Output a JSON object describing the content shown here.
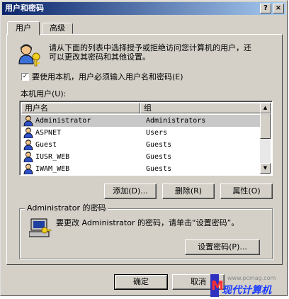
{
  "window": {
    "title": "用户和密码",
    "help_btn": "?",
    "close_btn": "×"
  },
  "tabs": [
    {
      "label": "用户"
    },
    {
      "label": "高级"
    }
  ],
  "intro": {
    "line1": "请从下面的列表中选择授予或拒绝访问您计算机的用户，还",
    "line2": "可以更改其密码和其他设置。"
  },
  "require_login": {
    "checked": true,
    "mark": "✓",
    "label": "要使用本机，用户必须输入用户名和密码(E)"
  },
  "users": {
    "label": "本机用户(U):",
    "columns": [
      "用户名",
      "组"
    ],
    "rows": [
      {
        "name": "Administrator",
        "group": "Administrators",
        "selected": true
      },
      {
        "name": "ASPNET",
        "group": "Users",
        "selected": false
      },
      {
        "name": "Guest",
        "group": "Guests",
        "selected": false
      },
      {
        "name": "IUSR_WEB",
        "group": "Guests",
        "selected": false
      },
      {
        "name": "IWAM_WEB",
        "group": "Guests",
        "selected": false
      }
    ],
    "scroll_up": "▲",
    "scroll_down": "▼"
  },
  "list_buttons": {
    "add": "添加(D)...",
    "remove": "删除(R)",
    "properties": "属性(O)"
  },
  "password_group": {
    "title": "Administrator 的密码",
    "text": "要更改 Administrator 的密码，请单击“设置密码”。",
    "set_button": "设置密码(P)..."
  },
  "footer": {
    "ok": "确定",
    "cancel": "取消"
  },
  "watermark": {
    "big": "现代计算机",
    "small": "www.pcmag.com"
  },
  "colors": {
    "title_start": "#0a246a",
    "title_end": "#a6caf0",
    "face": "#d4d0c8",
    "selection": "#c8c8c8"
  }
}
